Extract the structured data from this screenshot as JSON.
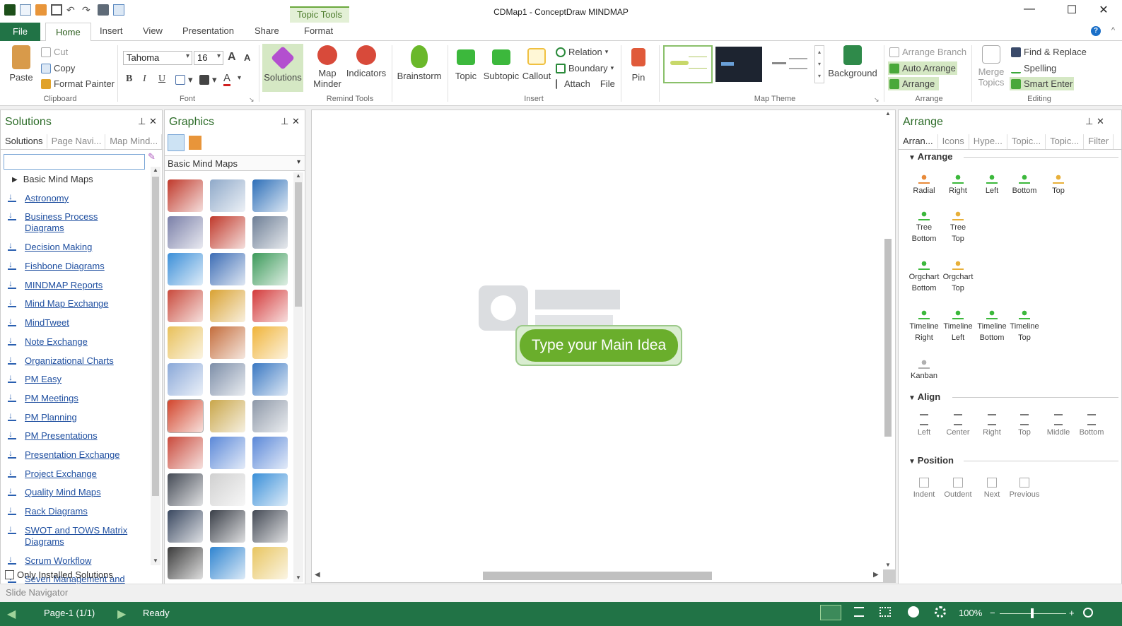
{
  "window": {
    "title": "CDMap1 - ConceptDraw MINDMAP",
    "context_tab": "Topic Tools",
    "minimize": "—",
    "maximize": "☐",
    "close": "✕"
  },
  "ribbon_tabs": {
    "file": "File",
    "home": "Home",
    "insert": "Insert",
    "view": "View",
    "presentation": "Presentation",
    "share": "Share",
    "format": "Format",
    "help": "?"
  },
  "clipboard": {
    "paste": "Paste",
    "cut": "Cut",
    "copy": "Copy",
    "format_painter": "Format Painter",
    "label": "Clipboard"
  },
  "font": {
    "family": "Tahoma",
    "size": "16",
    "grow": "A",
    "shrink": "A",
    "bold": "B",
    "italic": "I",
    "underline": "U",
    "font_color": "A",
    "label": "Font"
  },
  "remind_tools": {
    "solutions": "Solutions",
    "map_minder_1": "Map",
    "map_minder_2": "Minder",
    "indicators": "Indicators",
    "label": "Remind Tools"
  },
  "insert": {
    "brainstorm": "Brainstorm",
    "topic": "Topic",
    "subtopic": "Subtopic",
    "callout": "Callout",
    "relation": "Relation",
    "boundary": "Boundary",
    "attach": "Attach",
    "file": "File",
    "pin": "Pin",
    "label": "Insert"
  },
  "map_theme": {
    "background": "Background",
    "label": "Map Theme"
  },
  "arrange_group": {
    "arrange_branch": "Arrange Branch",
    "auto_arrange": "Auto Arrange",
    "arrange": "Arrange",
    "label": "Arrange"
  },
  "editing": {
    "merge_1": "Merge",
    "merge_2": "Topics",
    "find_replace": "Find & Replace",
    "spelling": "Spelling",
    "smart_enter": "Smart Enter",
    "label": "Editing"
  },
  "solutions_panel": {
    "title": "Solutions",
    "pin": "⊥",
    "close": "✕",
    "tabs": [
      "Solutions",
      "Page Navi...",
      "Map Mind..."
    ],
    "folder": "Basic Mind Maps",
    "items": [
      "Astronomy",
      "Business Process Diagrams",
      "Decision Making",
      "Fishbone Diagrams",
      "MINDMAP Reports",
      "Mind Map Exchange",
      "MindTweet",
      "Note Exchange",
      "Organizational Charts",
      "PM Easy",
      "PM Meetings",
      "PM Planning",
      "PM Presentations",
      "Presentation Exchange",
      "Project Exchange",
      "Quality Mind Maps",
      "Rack Diagrams",
      "SWOT and TOWS Matrix Diagrams",
      "Scrum Workflow",
      "Seven Management and"
    ],
    "only_installed": "Only Installed Solutions"
  },
  "graphics_panel": {
    "title": "Graphics",
    "pin": "⊥",
    "close": "✕",
    "library": "Basic Mind Maps",
    "cell_colors": [
      "#c0392b",
      "#8fa9c9",
      "#2d6fb8",
      "#7a7fa8",
      "#c0392b",
      "#6e7f96",
      "#3c8fd8",
      "#3d6db5",
      "#3c9a5a",
      "#c94a3c",
      "#d9a233",
      "#d33a3a",
      "#e8c05a",
      "#c46d3c",
      "#f0b43a",
      "#8aa8d8",
      "#7d8ea8",
      "#3a78c2",
      "#d2452c",
      "#c9a64a",
      "#8d98a8",
      "#c94a3c",
      "#5b88d8",
      "#5b88d8",
      "#444a55",
      "#d0d0d0",
      "#3a8fd8",
      "#3a4860",
      "#3a3f48",
      "#444a55",
      "#3b3b3b",
      "#2f84d0",
      "#e8c560"
    ]
  },
  "canvas": {
    "main_idea": "Type your Main Idea"
  },
  "arrange_panel": {
    "title": "Arrange",
    "pin": "⊥",
    "close": "✕",
    "tabs": [
      "Arran...",
      "Icons",
      "Hype...",
      "Topic...",
      "Topic...",
      "Filter"
    ],
    "section_arrange": "Arrange",
    "section_align": "Align",
    "section_position": "Position",
    "arrange_buttons": [
      [
        "Radial"
      ],
      [
        "Right"
      ],
      [
        "Left"
      ],
      [
        "Bottom"
      ],
      [
        "Top"
      ],
      [
        "Tree",
        "Bottom"
      ],
      [
        "Tree",
        "Top"
      ],
      [
        "Orgchart",
        "Bottom"
      ],
      [
        "Orgchart",
        "Top"
      ],
      [
        "Timeline",
        "Right"
      ],
      [
        "Timeline",
        "Left"
      ],
      [
        "Timeline",
        "Bottom"
      ],
      [
        "Timeline",
        "Top"
      ],
      [
        "Kanban"
      ]
    ],
    "align_buttons": [
      "Left",
      "Center",
      "Right",
      "Top",
      "Middle",
      "Bottom"
    ],
    "position_buttons": [
      "Indent",
      "Outdent",
      "Next",
      "Previous"
    ]
  },
  "slide_navigator": "Slide Navigator",
  "status": {
    "page": "Page-1 (1/1)",
    "state": "Ready",
    "zoom": "100%",
    "minus": "−",
    "plus": "+"
  }
}
